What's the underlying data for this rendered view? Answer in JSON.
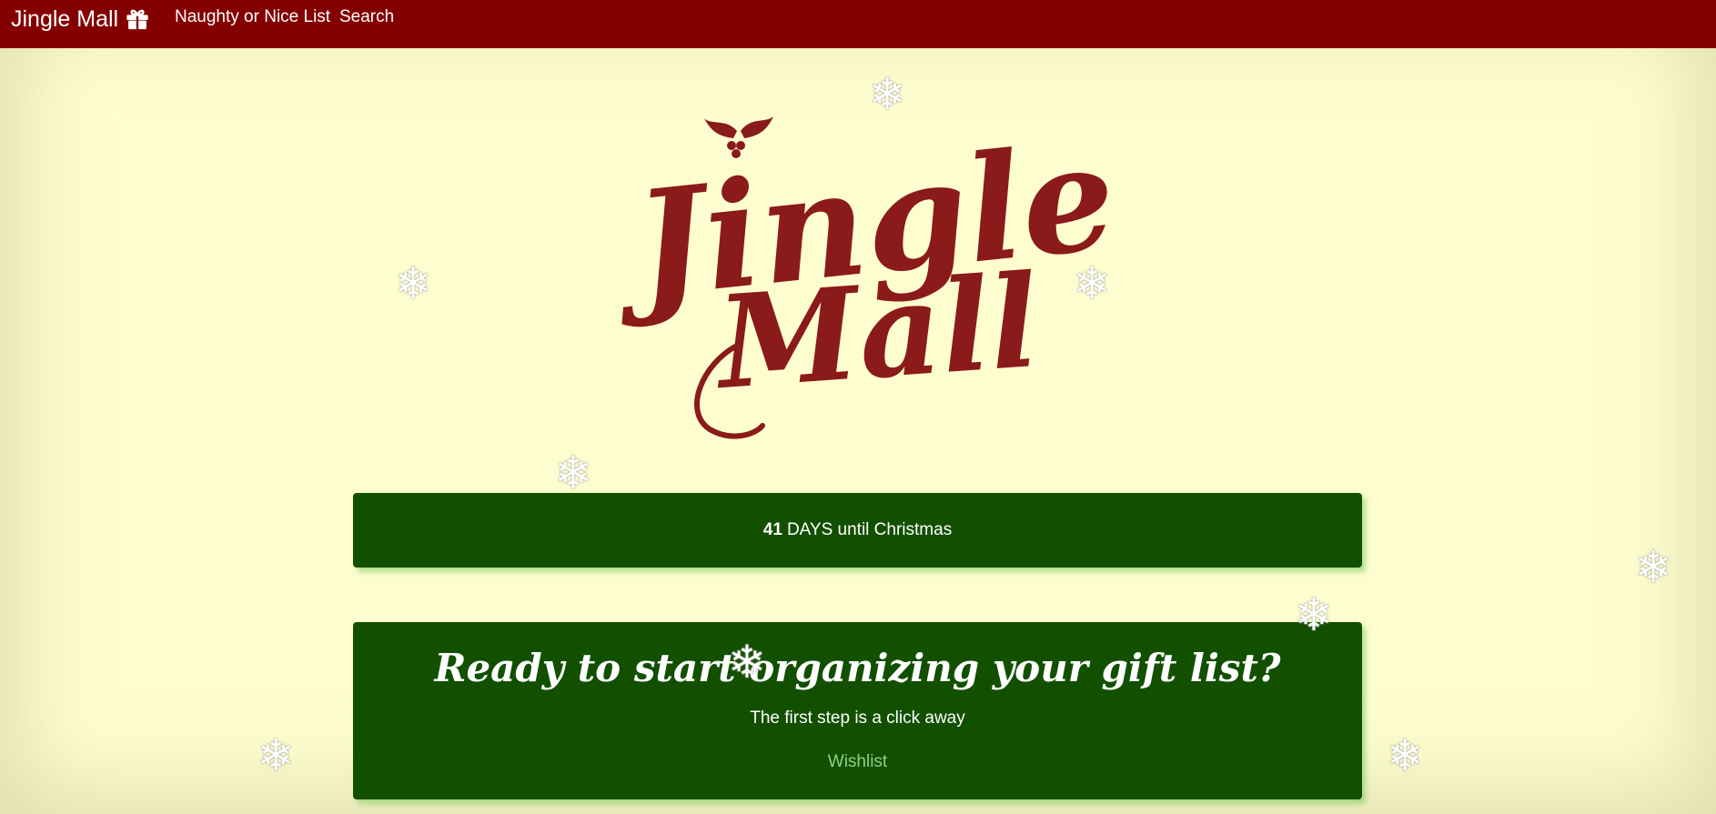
{
  "navbar": {
    "brand": "Jingle Mall",
    "brand_icon": "gift-icon",
    "links": [
      "Naughty or Nice List",
      "Search"
    ],
    "background": "#840000"
  },
  "logo": {
    "line1": "Jingle",
    "line2": "Mall",
    "color": "#8b1a1a",
    "decoration": "holly-icon"
  },
  "countdown": {
    "number": "41",
    "label": "DAYS until Christmas"
  },
  "cta": {
    "title": "Ready to start organizing your gift list?",
    "subtitle": "The first step is a click away",
    "link": "Wishlist"
  },
  "decorations": {
    "icon": "snowflake-icon",
    "glyph": "❄"
  },
  "colors": {
    "page_background": "#fdfdcf",
    "panel": "#125000",
    "link": "#8fd08a"
  }
}
